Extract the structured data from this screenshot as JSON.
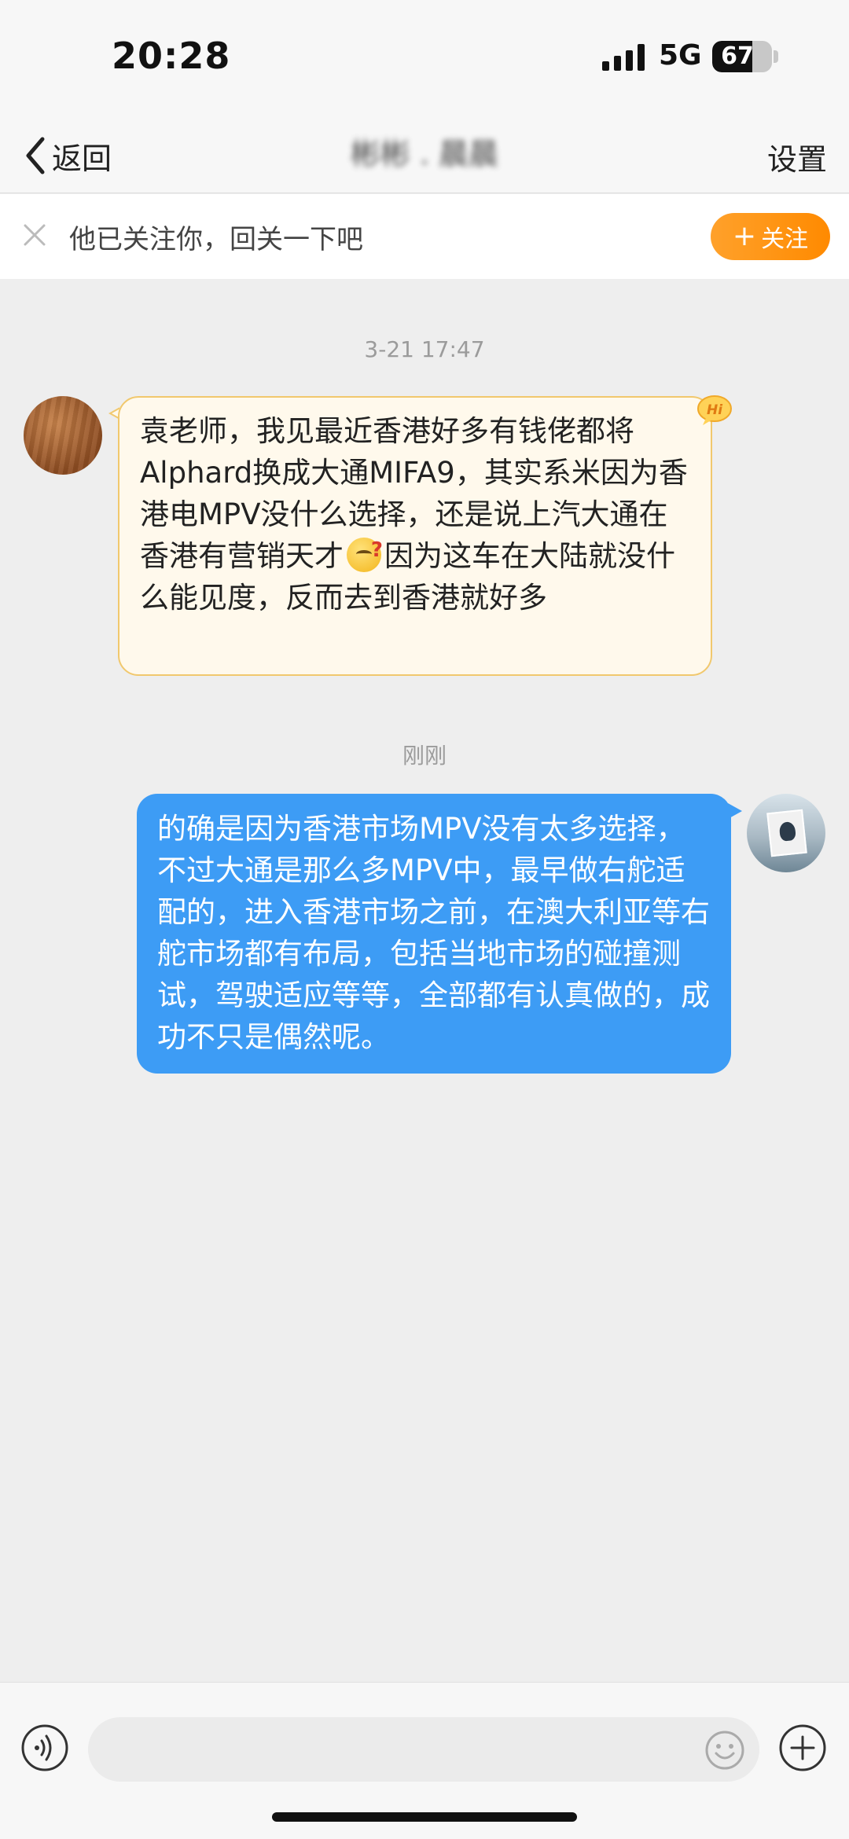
{
  "status_bar": {
    "time": "20:28",
    "network": "5G",
    "battery_percent": 67,
    "battery_label": "67"
  },
  "nav": {
    "back_label": "返回",
    "title": "彬彬 . 晨晨",
    "settings_label": "设置"
  },
  "follow_banner": {
    "text": "他已关注你，回关一下吧",
    "button_label": "关注"
  },
  "messages": [
    {
      "timestamp": "3-21 17:47",
      "direction": "incoming",
      "text_before_emoji": "袁老师，我见最近香港好多有钱佬都将Alphard换成大通MIFA9，其实系米因为香港电MPV没什么选择，还是说上汽大通在香港有营销天才",
      "emoji": "thinking-face-icon",
      "text_after_emoji": "因为这车在大陆就没什么能见度，反而去到香港就好多",
      "badge": "Hi"
    },
    {
      "timestamp": "刚刚",
      "direction": "outgoing",
      "text": "的确是因为香港市场MPV没有太多选择，不过大通是那么多MPV中，最早做右舵适配的，进入香港市场之前，在澳大利亚等右舵市场都有布局，包括当地市场的碰撞测试，驾驶适应等等，全部都有认真做的，成功不只是偶然呢。"
    }
  ],
  "input_bar": {
    "placeholder": ""
  },
  "colors": {
    "accent_orange": "#ff9a1f",
    "outgoing_bubble": "#3d9cf5",
    "incoming_bubble": "#fff9ec",
    "incoming_border": "#f1c86d"
  }
}
